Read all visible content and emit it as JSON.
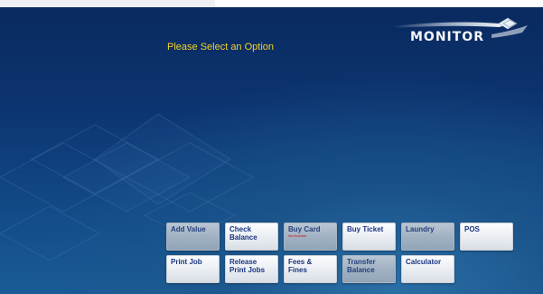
{
  "header": {
    "logo_text": "MONITOR",
    "prompt": "Please Select an Option"
  },
  "buttons": [
    {
      "label": "Add Value",
      "sublabel": "",
      "available": false
    },
    {
      "label": "Check Balance",
      "sublabel": "",
      "available": true
    },
    {
      "label": "Buy Card",
      "sublabel": "Not Available",
      "available": false
    },
    {
      "label": "Buy Ticket",
      "sublabel": "",
      "available": true
    },
    {
      "label": "Laundry",
      "sublabel": "",
      "available": false
    },
    {
      "label": "POS",
      "sublabel": "",
      "available": true
    },
    {
      "label": "Print Job",
      "sublabel": "",
      "available": true
    },
    {
      "label": "Release Print Jobs",
      "sublabel": "",
      "available": true
    },
    {
      "label": "Fees & Fines",
      "sublabel": "",
      "available": true
    },
    {
      "label": "Transfer Balance",
      "sublabel": "",
      "available": false
    },
    {
      "label": "Calculator",
      "sublabel": "",
      "available": true
    }
  ],
  "colors": {
    "background": "#0c3470",
    "prompt_text": "#f2d22a",
    "button_text": "#1c3580",
    "button_face": "#eef1f5",
    "button_disabled_face": "#a9b8c8",
    "notice_text": "#c21818"
  },
  "icons": {
    "logo_mark": "diamond-swoosh-logo"
  }
}
